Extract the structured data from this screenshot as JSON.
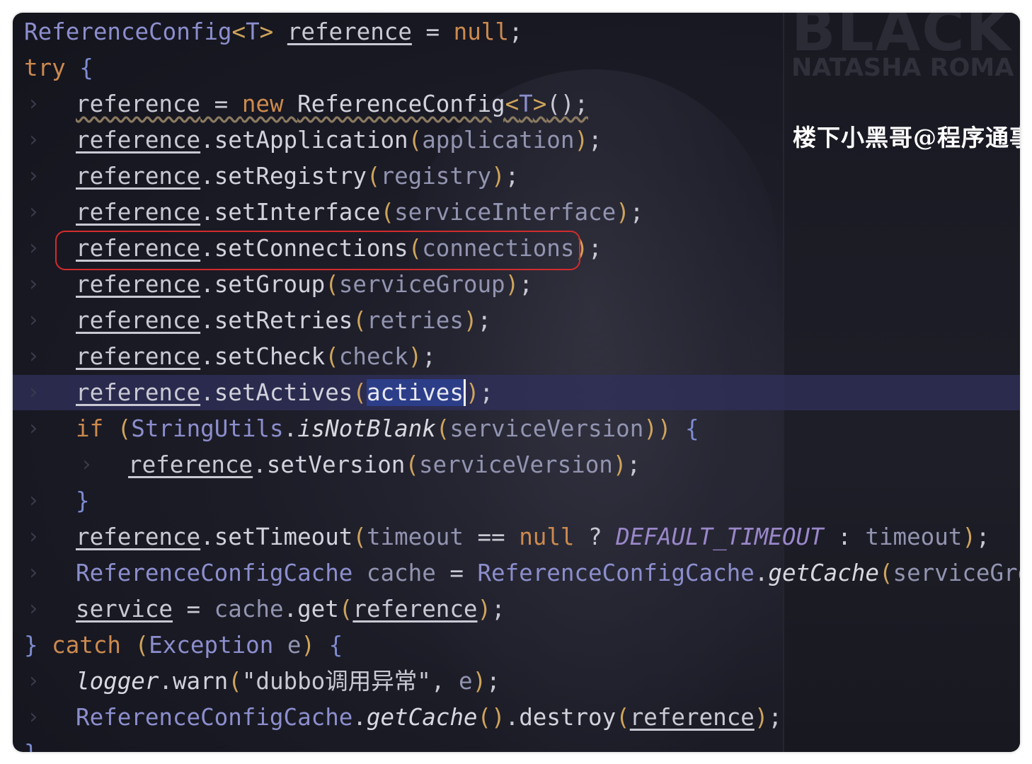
{
  "poster": {
    "title": "BLACK",
    "subtitle": "NATASHA ROMA"
  },
  "watermark": "楼下小黑哥@程序通事",
  "colors": {
    "keyword": "#cc8a4e",
    "type": "#8c8ecd",
    "parameter": "#9294b0",
    "highlight_box": "#d22c2c",
    "selection": "#2c3e88"
  },
  "code_lines": [
    {
      "gutter": "",
      "parts": [
        [
          "type",
          "ReferenceConfig"
        ],
        [
          "brk",
          "<"
        ],
        [
          "type",
          "T"
        ],
        [
          "brk",
          ">"
        ],
        [
          "pun",
          " "
        ],
        [
          "var",
          "reference"
        ],
        [
          "pun",
          " = "
        ],
        [
          "kw",
          "null"
        ],
        [
          "pun",
          ";"
        ]
      ]
    },
    {
      "gutter": "",
      "parts": [
        [
          "kw",
          "try"
        ],
        [
          "pun",
          " "
        ],
        [
          "brk2",
          "{"
        ]
      ]
    },
    {
      "gutter": "›",
      "parts": [
        [
          "var wavy",
          "reference"
        ],
        [
          "pun wavy",
          " = "
        ],
        [
          "kw wavy",
          "new"
        ],
        [
          "pun wavy",
          " "
        ],
        [
          "meth wavy",
          "ReferenceConfig"
        ],
        [
          "brk wavy",
          "<"
        ],
        [
          "type wavy",
          "T"
        ],
        [
          "brk wavy",
          ">"
        ],
        [
          "pun wavy",
          "();"
        ]
      ]
    },
    {
      "gutter": "›",
      "parts": [
        [
          "var",
          "reference"
        ],
        [
          "pun",
          "."
        ],
        [
          "meth",
          "setApplication"
        ],
        [
          "brk",
          "("
        ],
        [
          "par",
          "application"
        ],
        [
          "brk",
          ")"
        ],
        [
          "pun",
          ";"
        ]
      ]
    },
    {
      "gutter": "›",
      "parts": [
        [
          "var",
          "reference"
        ],
        [
          "pun",
          "."
        ],
        [
          "meth",
          "setRegistry"
        ],
        [
          "brk",
          "("
        ],
        [
          "par",
          "registry"
        ],
        [
          "brk",
          ")"
        ],
        [
          "pun",
          ";"
        ]
      ]
    },
    {
      "gutter": "›",
      "parts": [
        [
          "var",
          "reference"
        ],
        [
          "pun",
          "."
        ],
        [
          "meth",
          "setInterface"
        ],
        [
          "brk",
          "("
        ],
        [
          "par",
          "serviceInterface"
        ],
        [
          "brk",
          ")"
        ],
        [
          "pun",
          ";"
        ]
      ]
    },
    {
      "gutter": "›",
      "parts": [
        [
          "var",
          "reference"
        ],
        [
          "pun",
          "."
        ],
        [
          "meth",
          "setConnections"
        ],
        [
          "brk",
          "("
        ],
        [
          "par",
          "connections"
        ],
        [
          "brk",
          ")"
        ],
        [
          "pun",
          ";"
        ]
      ]
    },
    {
      "gutter": "›",
      "parts": [
        [
          "var",
          "reference"
        ],
        [
          "pun",
          "."
        ],
        [
          "meth",
          "setGroup"
        ],
        [
          "brk",
          "("
        ],
        [
          "par",
          "serviceGroup"
        ],
        [
          "brk",
          ")"
        ],
        [
          "pun",
          ";"
        ]
      ]
    },
    {
      "gutter": "›",
      "parts": [
        [
          "var",
          "reference"
        ],
        [
          "pun",
          "."
        ],
        [
          "meth",
          "setRetries"
        ],
        [
          "brk",
          "("
        ],
        [
          "par",
          "retries"
        ],
        [
          "brk",
          ")"
        ],
        [
          "pun",
          ";"
        ]
      ]
    },
    {
      "gutter": "›",
      "parts": [
        [
          "var",
          "reference"
        ],
        [
          "pun",
          "."
        ],
        [
          "meth",
          "setCheck"
        ],
        [
          "brk",
          "("
        ],
        [
          "par",
          "check"
        ],
        [
          "brk",
          ")"
        ],
        [
          "pun",
          ";"
        ]
      ]
    },
    {
      "gutter": "›",
      "parts": [
        [
          "var",
          "reference"
        ],
        [
          "pun",
          "."
        ],
        [
          "meth",
          "setActives"
        ],
        [
          "brk",
          "("
        ],
        [
          "sel caret",
          "actives"
        ],
        [
          "brk",
          ")"
        ],
        [
          "pun",
          ";"
        ]
      ]
    },
    {
      "gutter": "›",
      "parts": [
        [
          "kw",
          "if"
        ],
        [
          "pun",
          " "
        ],
        [
          "brk",
          "("
        ],
        [
          "type",
          "StringUtils"
        ],
        [
          "pun",
          "."
        ],
        [
          "ital",
          "isNotBlank"
        ],
        [
          "brk",
          "("
        ],
        [
          "par",
          "serviceVersion"
        ],
        [
          "brk",
          "))"
        ],
        [
          "pun",
          " "
        ],
        [
          "brk2",
          "{"
        ]
      ]
    },
    {
      "gutter": "›",
      "parts": [
        [
          "var",
          "reference"
        ],
        [
          "pun",
          "."
        ],
        [
          "meth",
          "setVersion"
        ],
        [
          "brk",
          "("
        ],
        [
          "par",
          "serviceVersion"
        ],
        [
          "brk",
          ")"
        ],
        [
          "pun",
          ";"
        ]
      ]
    },
    {
      "gutter": "›",
      "parts": [
        [
          "brk2",
          "}"
        ]
      ]
    },
    {
      "gutter": "›",
      "parts": [
        [
          "var",
          "reference"
        ],
        [
          "pun",
          "."
        ],
        [
          "meth",
          "setTimeout"
        ],
        [
          "brk",
          "("
        ],
        [
          "par",
          "timeout"
        ],
        [
          "pun",
          " == "
        ],
        [
          "kw",
          "null"
        ],
        [
          "pun",
          " ? "
        ],
        [
          "const",
          "DEFAULT_TIMEOUT"
        ],
        [
          "pun",
          " : "
        ],
        [
          "par",
          "timeout"
        ],
        [
          "brk",
          ")"
        ],
        [
          "pun",
          ";"
        ]
      ]
    },
    {
      "gutter": "›",
      "parts": [
        [
          "type",
          "ReferenceConfigCache"
        ],
        [
          "pun",
          " "
        ],
        [
          "par",
          "cache"
        ],
        [
          "pun",
          " = "
        ],
        [
          "type",
          "ReferenceConfigCache"
        ],
        [
          "pun",
          "."
        ],
        [
          "ital",
          "getCache"
        ],
        [
          "brk",
          "("
        ],
        [
          "par",
          "serviceGroup"
        ],
        [
          "brk",
          ")"
        ]
      ]
    },
    {
      "gutter": "›",
      "parts": [
        [
          "var",
          "service"
        ],
        [
          "pun",
          " = "
        ],
        [
          "par",
          "cache"
        ],
        [
          "pun",
          "."
        ],
        [
          "meth",
          "get"
        ],
        [
          "brk",
          "("
        ],
        [
          "var",
          "reference"
        ],
        [
          "brk",
          ")"
        ],
        [
          "pun",
          ";"
        ]
      ]
    },
    {
      "gutter": "",
      "parts": [
        [
          "brk2",
          "}"
        ],
        [
          "pun",
          " "
        ],
        [
          "kw",
          "catch"
        ],
        [
          "pun",
          " "
        ],
        [
          "brk",
          "("
        ],
        [
          "type",
          "Exception"
        ],
        [
          "pun",
          " "
        ],
        [
          "par",
          "e"
        ],
        [
          "brk",
          ")"
        ],
        [
          "pun",
          " "
        ],
        [
          "brk2",
          "{"
        ]
      ]
    },
    {
      "gutter": "›",
      "parts": [
        [
          "ital",
          "logger"
        ],
        [
          "pun",
          "."
        ],
        [
          "meth",
          "warn"
        ],
        [
          "brk",
          "("
        ],
        [
          "str",
          "\"dubbo调用异常\""
        ],
        [
          "pun",
          ", "
        ],
        [
          "par",
          "e"
        ],
        [
          "brk",
          ")"
        ],
        [
          "pun",
          ";"
        ]
      ]
    },
    {
      "gutter": "›",
      "parts": [
        [
          "type",
          "ReferenceConfigCache"
        ],
        [
          "pun",
          "."
        ],
        [
          "ital",
          "getCache"
        ],
        [
          "brk",
          "()"
        ],
        [
          "pun",
          "."
        ],
        [
          "meth",
          "destroy"
        ],
        [
          "brk",
          "("
        ],
        [
          "var",
          "reference"
        ],
        [
          "brk",
          ")"
        ],
        [
          "pun",
          ";"
        ]
      ]
    },
    {
      "gutter": "",
      "parts": [
        [
          "brk2",
          "}"
        ]
      ]
    }
  ]
}
